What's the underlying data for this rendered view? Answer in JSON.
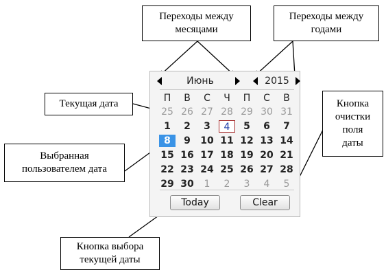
{
  "annotations": {
    "month_nav": "Переходы между\nмесяцами",
    "year_nav": "Переходы между\nгодами",
    "current_date": "Текущая дата",
    "selected_date": "Выбранная\nпользователем дата",
    "clear_button": "Кнопка\nочистки\nполя\nдаты",
    "today_button": "Кнопка выбора\nтекущей даты"
  },
  "calendar": {
    "month": "Июнь",
    "year": "2015",
    "weekdays": [
      "П",
      "В",
      "С",
      "Ч",
      "П",
      "С",
      "В"
    ],
    "weeks": [
      [
        {
          "d": "25",
          "other": true
        },
        {
          "d": "26",
          "other": true
        },
        {
          "d": "27",
          "other": true
        },
        {
          "d": "28",
          "other": true
        },
        {
          "d": "29",
          "other": true
        },
        {
          "d": "30",
          "other": true
        },
        {
          "d": "31",
          "other": true
        }
      ],
      [
        {
          "d": "1"
        },
        {
          "d": "2"
        },
        {
          "d": "3"
        },
        {
          "d": "4",
          "today": true
        },
        {
          "d": "5"
        },
        {
          "d": "6"
        },
        {
          "d": "7"
        }
      ],
      [
        {
          "d": "8",
          "selected": true
        },
        {
          "d": "9"
        },
        {
          "d": "10"
        },
        {
          "d": "11"
        },
        {
          "d": "12"
        },
        {
          "d": "13"
        },
        {
          "d": "14"
        }
      ],
      [
        {
          "d": "15"
        },
        {
          "d": "16"
        },
        {
          "d": "17"
        },
        {
          "d": "18"
        },
        {
          "d": "19"
        },
        {
          "d": "20"
        },
        {
          "d": "21"
        }
      ],
      [
        {
          "d": "22"
        },
        {
          "d": "23"
        },
        {
          "d": "24"
        },
        {
          "d": "25"
        },
        {
          "d": "26"
        },
        {
          "d": "27"
        },
        {
          "d": "28"
        }
      ],
      [
        {
          "d": "29"
        },
        {
          "d": "30"
        },
        {
          "d": "1",
          "other": true
        },
        {
          "d": "2",
          "other": true
        },
        {
          "d": "3",
          "other": true
        },
        {
          "d": "4",
          "other": true
        },
        {
          "d": "5",
          "other": true
        }
      ]
    ],
    "today_label": "Today",
    "clear_label": "Clear"
  },
  "icons": {
    "prev_month": "left-triangle-icon",
    "next_month": "right-triangle-icon",
    "prev_year": "left-triangle-icon",
    "next_year": "right-triangle-icon"
  },
  "colors": {
    "selected_bg": "#3a93e6",
    "today_border": "#a52a2a",
    "today_text": "#1a3aa8",
    "other_month_text": "#9a9a9a"
  }
}
